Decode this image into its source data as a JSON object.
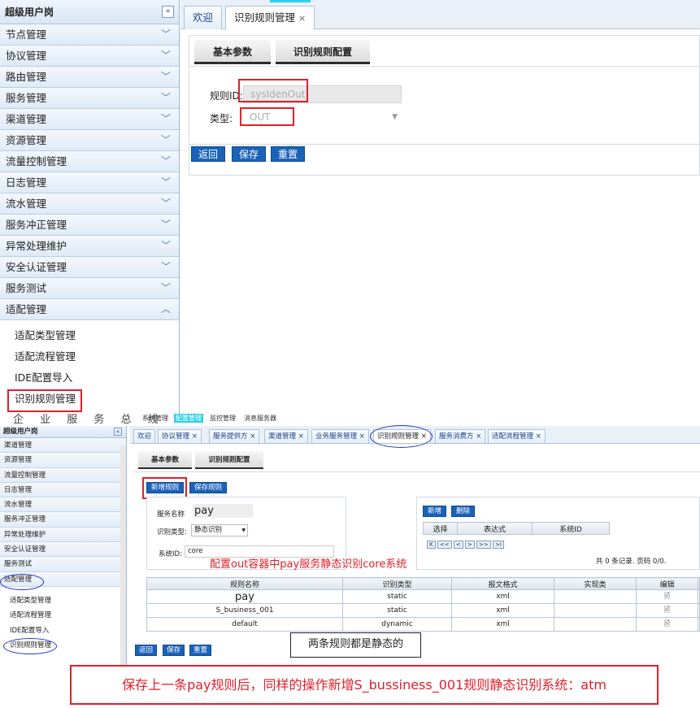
{
  "top": {
    "sidebar": {
      "title": "超级用户岗",
      "collapse_icon": "«",
      "items": [
        "节点管理",
        "协议管理",
        "路由管理",
        "服务管理",
        "渠道管理",
        "资源管理",
        "流量控制管理",
        "日志管理",
        "流水管理",
        "服务冲正管理",
        "异常处理维护",
        "安全认证管理",
        "服务测试",
        "适配管理"
      ],
      "sub_items": [
        "适配类型管理",
        "适配流程管理",
        "IDE配置导入",
        "识别规则管理"
      ]
    },
    "tabs": [
      {
        "label": "欢迎"
      },
      {
        "label": "识别规则管理",
        "close": "×"
      }
    ],
    "subtabs": [
      "基本参数",
      "识别规则配置"
    ],
    "form": {
      "rule_id_label": "规则ID:",
      "rule_id_value": "sysIdenOut",
      "type_label": "类型:",
      "type_value": "OUT"
    },
    "buttons": [
      "返回",
      "保存",
      "重置"
    ]
  },
  "bottom": {
    "brand": "企 业 服 务 总 线",
    "top_menu": [
      "系统管理",
      "配置管理",
      "监控管理",
      "消息服务器"
    ],
    "sidebar": {
      "title": "超级用户岗",
      "collapse_icon": "«",
      "items": [
        "渠道管理",
        "资源管理",
        "流量控制管理",
        "日志管理",
        "流水管理",
        "服务冲正管理",
        "异常处理维护",
        "安全认证管理",
        "服务测试",
        "适配管理"
      ],
      "sub_items": [
        "适配类型管理",
        "适配流程管理",
        "IDE配置导入",
        "识别规则管理"
      ]
    },
    "tabs": [
      "欢迎",
      "协议管理 ×",
      "服务提供方 ×",
      "渠道管理 ×",
      "业务服务管理 ×",
      "识别规则管理 ×",
      "服务消费方 ×",
      "适配流程管理 ×"
    ],
    "subtabs": [
      "基本参数",
      "识别规则配置"
    ],
    "rule_buttons": [
      "新增规则",
      "保存规则"
    ],
    "form": {
      "service_name_label": "服务名称",
      "service_name_value": "pay",
      "ident_type_label": "识别类型:",
      "ident_type_value": "静态识别",
      "system_id_label": "系统ID:",
      "system_id_value": "core"
    },
    "expr_panel": {
      "buttons": [
        "新增",
        "删除"
      ],
      "headers": [
        "选择",
        "表达式",
        "系统ID"
      ],
      "pager": [
        "K",
        "<<",
        "<",
        ">",
        ">>",
        ">I"
      ],
      "summary": "共 0 条记录. 页码 0/0."
    },
    "annotation_1": "配置out容器中pay服务静态识别core系统",
    "rules_table": {
      "headers": [
        "规则名称",
        "识别类型",
        "报文格式",
        "实现类",
        "编辑"
      ],
      "rows": [
        {
          "name": "pay",
          "type": "static",
          "format": "xml",
          "impl": "",
          "edit": "🖹"
        },
        {
          "name": "S_business_001",
          "type": "static",
          "format": "xml",
          "impl": "",
          "edit": "🖹"
        },
        {
          "name": "default",
          "type": "dynamic",
          "format": "xml",
          "impl": "",
          "edit": "🖹"
        }
      ]
    },
    "annotation_2": "两条规则都是静态的",
    "buttons": [
      "返回",
      "保存",
      "重置"
    ],
    "caption": "保存上一条pay规则后，同样的操作新增S_bussiness_001规则静态识别系统：atm"
  }
}
